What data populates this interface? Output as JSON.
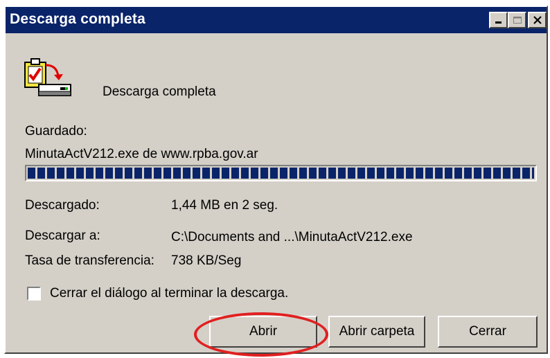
{
  "window": {
    "title": "Descarga completa"
  },
  "header": {
    "status_text": "Descarga completa",
    "icon": "download-complete-icon"
  },
  "details": {
    "saved_label": "Guardado:",
    "file_source": "MinutaActV212.exe de www.rpba.gov.ar",
    "progress_fraction": 1.0,
    "downloaded_label": "Descargado:",
    "downloaded_value": "1,44 MB en 2 seg.",
    "destination_label": "Descargar a:",
    "destination_value": "C:\\Documents and ...\\MinutaActV212.exe",
    "rate_label": "Tasa de transferencia:",
    "rate_value": "738 KB/Seg"
  },
  "options": {
    "close_on_finish_label": "Cerrar el diálogo al terminar la descarga.",
    "close_on_finish_checked": false
  },
  "buttons": {
    "open_label": "Abrir",
    "open_folder_label": "Abrir carpeta",
    "close_label": "Cerrar"
  },
  "colors": {
    "titlebar": "#0a246a",
    "progress": "#0a246a",
    "dialog_bg": "#d4d0c8",
    "highlight_annotation": "#e02020"
  }
}
